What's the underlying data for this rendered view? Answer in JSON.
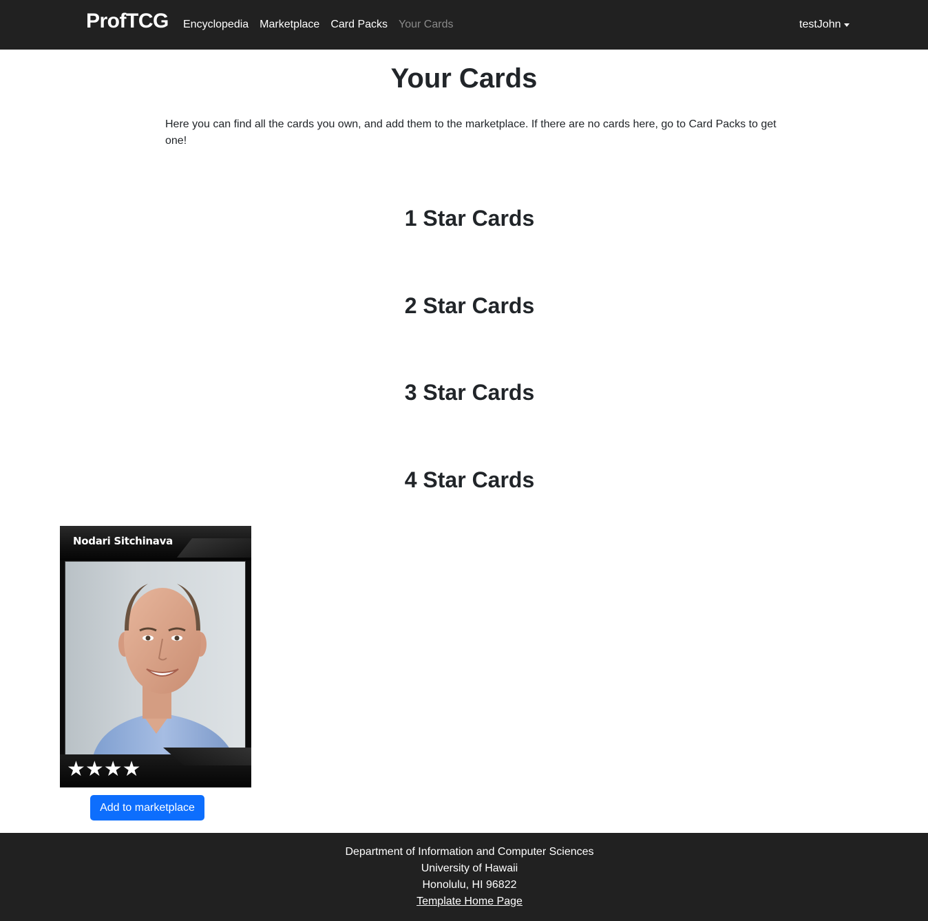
{
  "navbar": {
    "brand": "ProfTCG",
    "links": [
      {
        "label": "Encyclopedia",
        "active": false
      },
      {
        "label": "Marketplace",
        "active": false
      },
      {
        "label": "Card Packs",
        "active": false
      },
      {
        "label": "Your Cards",
        "active": true
      }
    ],
    "user": "testJohn",
    "user_icon": "caret-down-icon"
  },
  "main": {
    "title": "Your Cards",
    "intro": "Here you can find all the cards you own, and add them to the marketplace. If there are no cards here, go to Card Packs to get one!",
    "sections": [
      {
        "heading": "1 Star Cards",
        "cards": []
      },
      {
        "heading": "2 Star Cards",
        "cards": []
      },
      {
        "heading": "3 Star Cards",
        "cards": []
      },
      {
        "heading": "4 Star Cards",
        "cards": [
          {
            "name": "Nodari Sitchinava",
            "stars": 4,
            "stars_text": "★★★★",
            "action_label": "Add to marketplace"
          }
        ]
      }
    ]
  },
  "footer": {
    "lines": [
      "Department of Information and Computer Sciences",
      "University of Hawaii",
      "Honolulu, HI 96822"
    ],
    "link_label": "Template Home Page"
  },
  "colors": {
    "navbar_bg": "#212121",
    "primary": "#0d6efd",
    "active_link": "#8a8a8a"
  }
}
